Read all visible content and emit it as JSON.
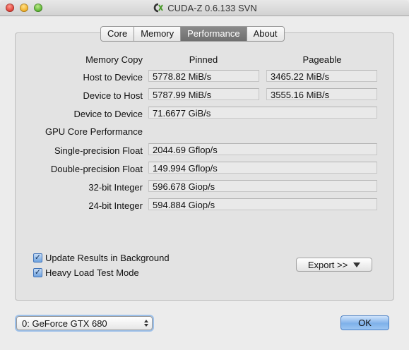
{
  "window": {
    "title": "CUDA-Z 0.6.133 SVN",
    "app_icon": "cuda-z-logo-icon"
  },
  "tabs": [
    {
      "label": "Core",
      "active": false
    },
    {
      "label": "Memory",
      "active": false
    },
    {
      "label": "Performance",
      "active": true
    },
    {
      "label": "About",
      "active": false
    }
  ],
  "memory_copy": {
    "header": "Memory Copy",
    "col_pinned": "Pinned",
    "col_pageable": "Pageable",
    "rows": [
      {
        "label": "Host to Device",
        "pinned": "5778.82 MiB/s",
        "pageable": "3465.22 MiB/s"
      },
      {
        "label": "Device to Host",
        "pinned": "5787.99 MiB/s",
        "pageable": "3555.16 MiB/s"
      },
      {
        "label": "Device to Device",
        "value": "71.6677 GiB/s"
      }
    ]
  },
  "gpu_core": {
    "header": "GPU Core Performance",
    "rows": [
      {
        "label": "Single-precision Float",
        "value": "2044.69 Gflop/s"
      },
      {
        "label": "Double-precision Float",
        "value": "149.994 Gflop/s"
      },
      {
        "label": "32-bit Integer",
        "value": "596.678 Giop/s"
      },
      {
        "label": "24-bit Integer",
        "value": "594.884 Giop/s"
      }
    ]
  },
  "options": {
    "update_background": {
      "label": "Update Results in Background",
      "checked": true
    },
    "heavy_load": {
      "label": "Heavy Load Test Mode",
      "checked": true
    }
  },
  "export_button": {
    "label": "Export >>"
  },
  "device_select": {
    "value": "0: GeForce GTX 680"
  },
  "ok_button": {
    "label": "OK"
  },
  "colors": {
    "accent": "#6ea2de",
    "active_tab": "#7a7a7a",
    "panel": "#e3e3e3"
  }
}
